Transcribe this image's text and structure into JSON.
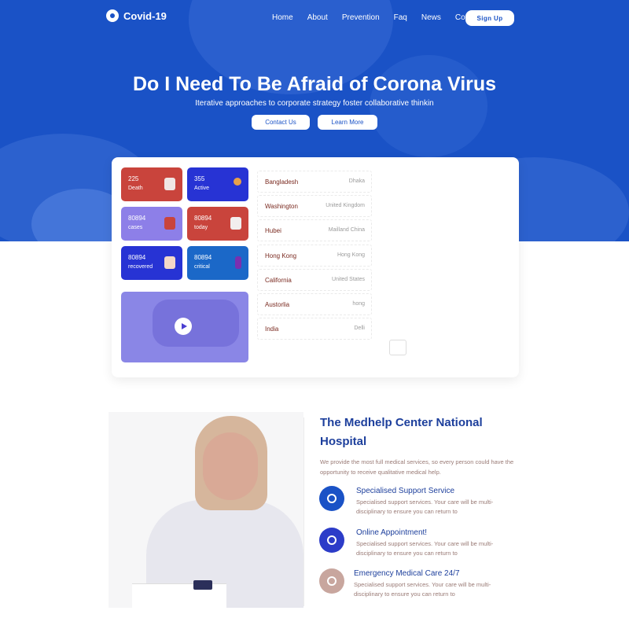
{
  "brand": {
    "name": "Covid-19"
  },
  "nav": {
    "items": [
      "Home",
      "About",
      "Prevention",
      "Faq",
      "News",
      "Contact"
    ],
    "signup_label": "Sign Up"
  },
  "hero": {
    "title": "Do I Need To Be Afraid of Corona Virus",
    "subtitle": "Iterative approaches to corporate strategy foster collaborative thinkin",
    "contact_label": "Contact Us",
    "more_label": "Learn More"
  },
  "stats": [
    {
      "value": "225",
      "label": "Death",
      "color": "#c9443c",
      "icon": "doctor-icon"
    },
    {
      "value": "355",
      "label": "Active",
      "color": "#2733d4",
      "icon": "virus-molecule-icon"
    },
    {
      "value": "80894",
      "label": "cases",
      "color": "#8d7fe8",
      "icon": "box-icon"
    },
    {
      "value": "80894",
      "label": "today",
      "color": "#c9443c",
      "icon": "report-icon"
    },
    {
      "value": "80894",
      "label": "recovered",
      "color": "#2733d4",
      "icon": "nurse-icon"
    },
    {
      "value": "80894",
      "label": "critical",
      "color": "#1b68c8",
      "icon": "sanitizer-icon"
    }
  ],
  "locations": [
    {
      "city": "Bangladesh",
      "region": "Dhaka"
    },
    {
      "city": "Washington",
      "region": "United Kingdom"
    },
    {
      "city": "Hubei",
      "region": "Mailland China"
    },
    {
      "city": "Hong Kong",
      "region": "Hong Kong"
    },
    {
      "city": "California",
      "region": "United States"
    },
    {
      "city": "Austorlia",
      "region": "hong"
    },
    {
      "city": "India",
      "region": "Delli"
    }
  ],
  "about": {
    "title": "The Medhelp Center National Hospital",
    "description": "We provide the most full medical services, so every person could have the opportunity to receive qualitative medical help.",
    "features": [
      {
        "title": "Specialised Support Service",
        "description": "Specialised support services. Your care will be multi-disciplinary to ensure you can return to"
      },
      {
        "title": "Online Appointment!",
        "description": "Specialised support services. Your care will be multi-disciplinary to ensure you can return to"
      },
      {
        "title": "Emergency Medical Care 24/7",
        "description": "Specialised support services. Your care will be multi-disciplinary to ensure you can return to"
      }
    ]
  },
  "colors": {
    "primary": "#1a52c6",
    "heading": "#1d3f9c",
    "accent_red": "#c9443c"
  }
}
